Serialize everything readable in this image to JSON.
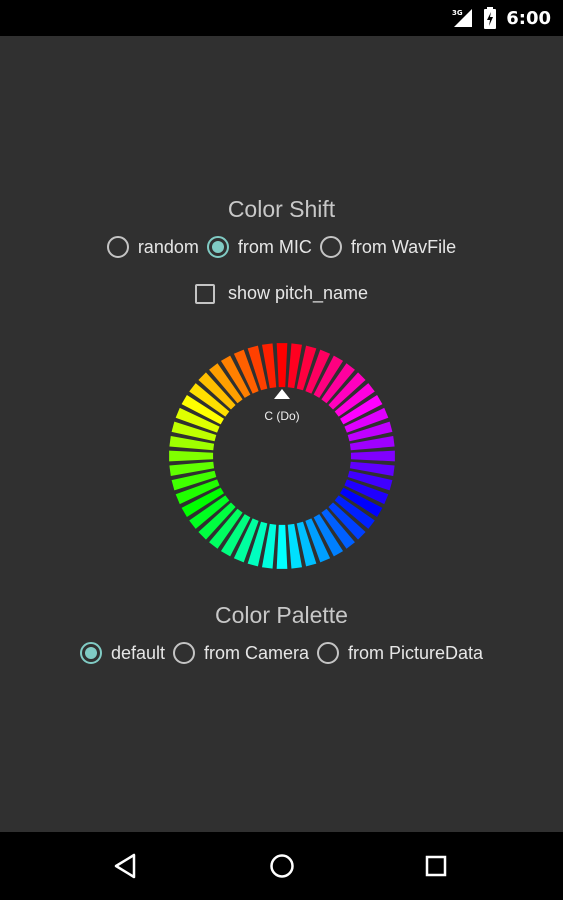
{
  "status_bar": {
    "network": "3G",
    "time": "6:00",
    "signal_icon": "signal-icon",
    "battery_icon": "battery-charging-icon"
  },
  "color_shift": {
    "title": "Color Shift",
    "options": [
      {
        "label": "random",
        "checked": false
      },
      {
        "label": "from MIC",
        "checked": true
      },
      {
        "label": "from WavFile",
        "checked": false
      }
    ],
    "show_pitch_name": {
      "label": "show pitch_name",
      "checked": false
    }
  },
  "wheel": {
    "pitch_label": "C (Do)",
    "segments": 48,
    "pointer_icon": "triangle-up-icon"
  },
  "color_palette": {
    "title": "Color Palette",
    "options": [
      {
        "label": "default",
        "checked": true
      },
      {
        "label": "from Camera",
        "checked": false
      },
      {
        "label": "from PictureData",
        "checked": false
      }
    ]
  },
  "nav_bar": {
    "back_icon": "back-icon",
    "home_icon": "home-icon",
    "recents_icon": "recents-icon"
  },
  "colors": {
    "accent": "#80cbc4",
    "background": "#303030",
    "bar": "#000000"
  }
}
